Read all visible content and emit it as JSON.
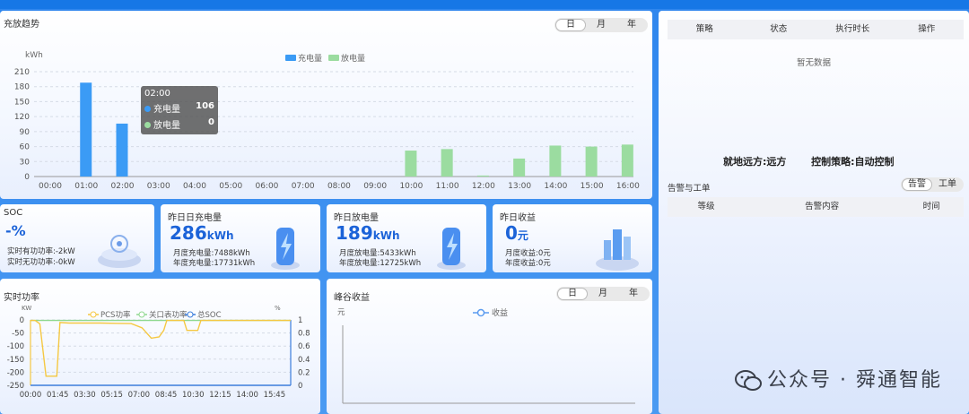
{
  "charge_panel": {
    "title": "充放趋势",
    "period_tabs": [
      "日",
      "月",
      "年"
    ],
    "active_tab": "日",
    "tooltip": {
      "time": "02:00",
      "charge_label": "充电量",
      "charge_value": "106",
      "discharge_label": "放电量",
      "discharge_value": "0"
    }
  },
  "soc_card": {
    "title": "SOC",
    "value": "-%",
    "line1": "实时有功功率:-2kW",
    "line2": "实时无功功率:-0kW"
  },
  "charge_card": {
    "title": "昨日日充电量",
    "value": "286",
    "unit": "kWh",
    "line1": "月度充电量:7488kWh",
    "line2": "年度充电量:17731kWh"
  },
  "discharge_card": {
    "title": "昨日放电量",
    "value": "189",
    "unit": "kWh",
    "line1": "月度放电量:5433kWh",
    "line2": "年度放电量:12725kWh"
  },
  "income_card": {
    "title": "昨日收益",
    "value": "0",
    "unit": "元",
    "line1": "月度收益:0元",
    "line2": "年度收益:0元"
  },
  "power_panel": {
    "title": "实时功率"
  },
  "peak_panel": {
    "title": "峰谷收益",
    "period_tabs": [
      "日",
      "月",
      "年"
    ],
    "active_tab": "日"
  },
  "strategy_panel": {
    "columns": [
      "策略",
      "状态",
      "执行时长",
      "操作"
    ],
    "empty_text": "暂无数据",
    "local_remote_label": "就地远方:",
    "local_remote_value": "远方",
    "control_label": "控制策略:",
    "control_value": "自动控制"
  },
  "alarm_panel": {
    "title": "告警与工单",
    "tabs": [
      "告警",
      "工单"
    ],
    "active_tab": "告警",
    "columns": [
      "等级",
      "告警内容",
      "时间"
    ]
  },
  "watermark": "公众号 · 舜通智能",
  "colors": {
    "charge": "#3b9bf5",
    "discharge": "#9bdca0",
    "pcs": "#f5c842",
    "gateway": "#8fd88f",
    "soc": "#3b7ddc",
    "accent": "#1c63d8"
  },
  "chart_data": [
    {
      "type": "bar",
      "title": "充放趋势",
      "ylabel": "kWh",
      "ylim": [
        0,
        210
      ],
      "yticks": [
        0,
        30,
        60,
        90,
        120,
        150,
        180,
        210
      ],
      "categories": [
        "00:00",
        "01:00",
        "02:00",
        "03:00",
        "04:00",
        "05:00",
        "06:00",
        "07:00",
        "08:00",
        "09:00",
        "10:00",
        "11:00",
        "12:00",
        "13:00",
        "14:00",
        "15:00",
        "16:00"
      ],
      "series": [
        {
          "name": "充电量",
          "values": [
            0,
            188,
            106,
            0,
            0,
            0,
            0,
            0,
            0,
            0,
            0,
            0,
            0,
            0,
            0,
            0,
            0
          ]
        },
        {
          "name": "放电量",
          "values": [
            0,
            0,
            0,
            0,
            0,
            0,
            0,
            0,
            0,
            0,
            52,
            55,
            2,
            36,
            62,
            60,
            64
          ]
        }
      ],
      "legend_position": "top-center",
      "grid": true
    },
    {
      "type": "line",
      "title": "实时功率",
      "ylabel": "KW",
      "ylabel_right": "%",
      "ylim": [
        -250,
        0
      ],
      "yticks": [
        0,
        -50,
        -100,
        -150,
        -200,
        -250
      ],
      "ylim_right": [
        0,
        1
      ],
      "yticks_right": [
        0,
        0.2,
        0.4,
        0.6,
        0.8,
        1
      ],
      "x": [
        "00:00",
        "01:45",
        "03:30",
        "05:15",
        "07:00",
        "08:45",
        "10:30",
        "12:15",
        "14:00",
        "15:45"
      ],
      "series": [
        {
          "name": "PCS功率",
          "points": [
            [
              0,
              -2
            ],
            [
              0.3,
              -2
            ],
            [
              0.6,
              -15
            ],
            [
              1.0,
              -215
            ],
            [
              1.7,
              -215
            ],
            [
              1.9,
              -10
            ],
            [
              2.5,
              -12
            ],
            [
              3.5,
              -12
            ],
            [
              4.5,
              -12
            ],
            [
              6.5,
              -14
            ],
            [
              7.2,
              -30
            ],
            [
              7.8,
              -70
            ],
            [
              8.3,
              -65
            ],
            [
              8.6,
              -40
            ],
            [
              8.8,
              -2
            ],
            [
              9.9,
              -2
            ],
            [
              10.1,
              -40
            ],
            [
              10.8,
              -40
            ],
            [
              11.0,
              -2
            ],
            [
              16.8,
              -2
            ]
          ]
        },
        {
          "name": "关口表功率",
          "points": [
            [
              0,
              -2
            ],
            [
              16.8,
              -2
            ]
          ]
        },
        {
          "name": "总SOC",
          "points": [
            [
              0,
              0
            ],
            [
              16.8,
              0
            ]
          ]
        }
      ],
      "legend_position": "top-center",
      "grid": true
    },
    {
      "type": "line",
      "title": "峰谷收益",
      "ylabel": "元",
      "series": [
        {
          "name": "收益",
          "values": []
        }
      ],
      "legend_position": "top-center"
    }
  ]
}
